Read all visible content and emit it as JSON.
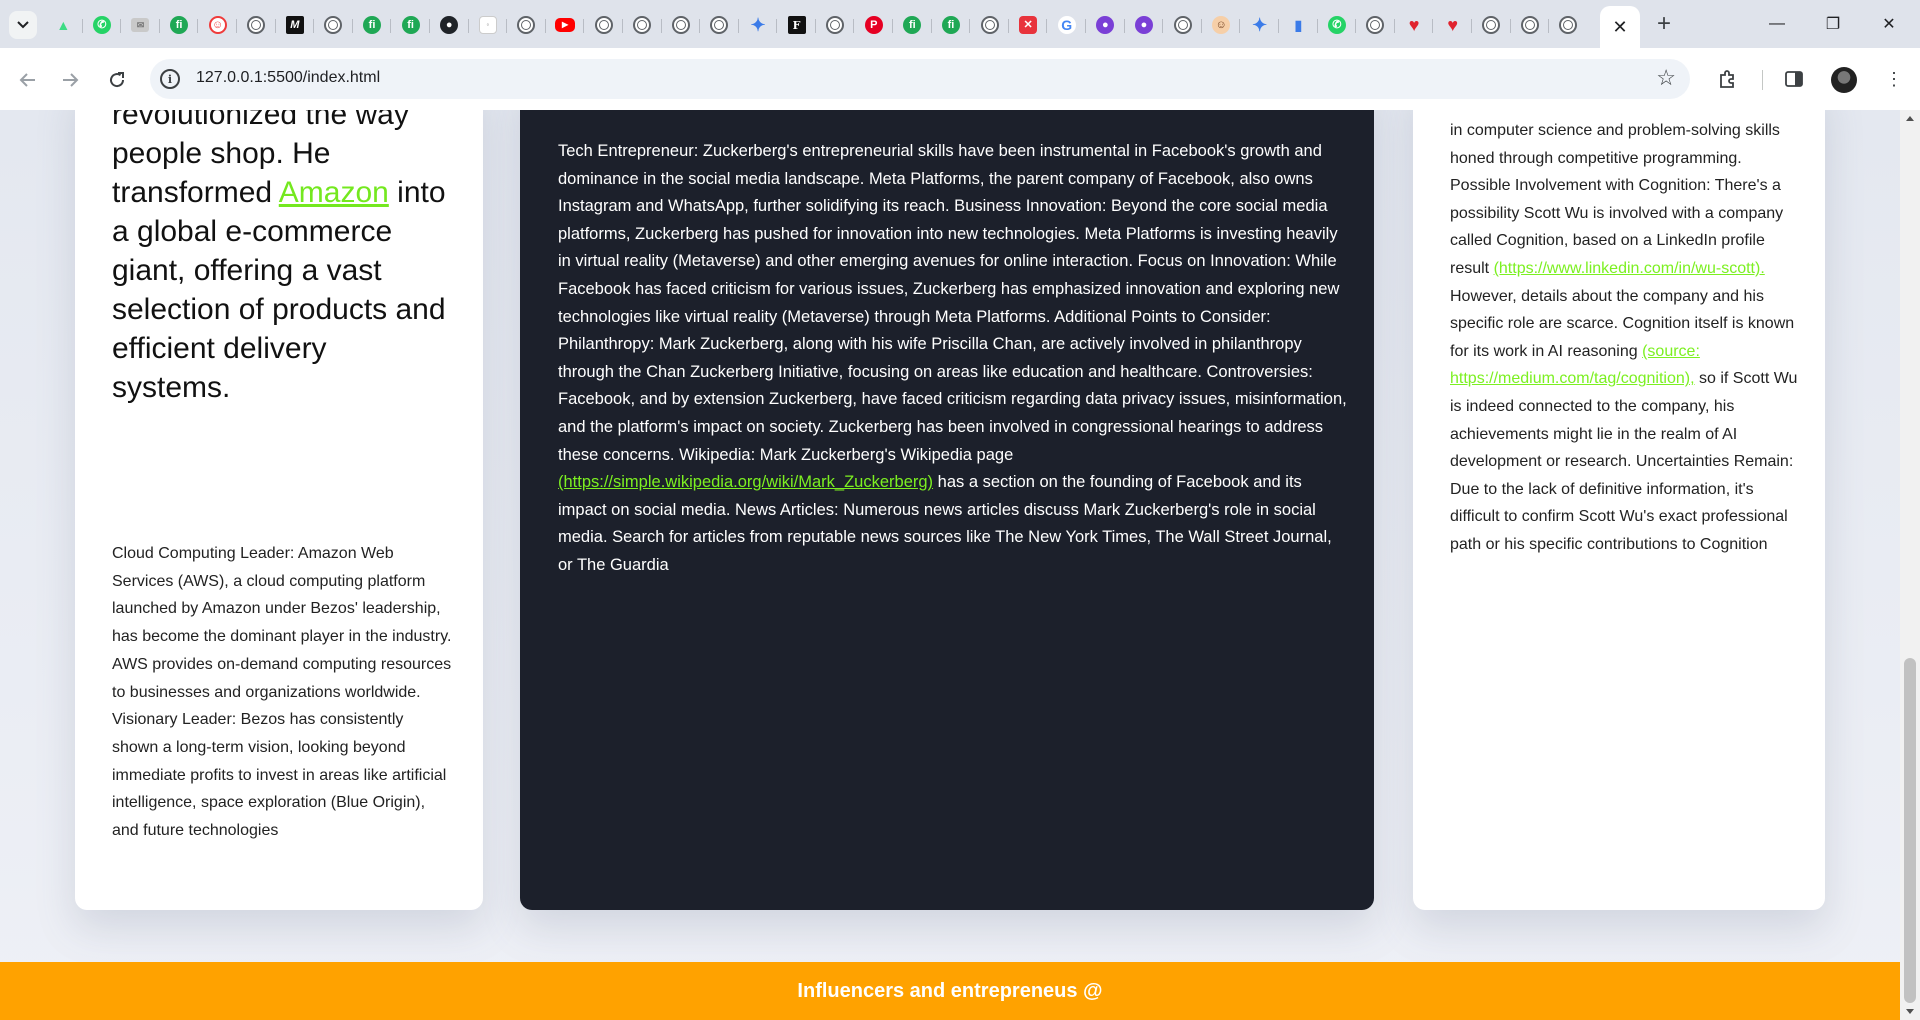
{
  "browser": {
    "url": "127.0.0.1:5500/index.html",
    "tab_favicons": [
      "chevron-down-icon",
      "android-icon",
      "whatsapp-icon",
      "mail-icon",
      "fiverr-icon",
      "smiley-icon",
      "chrome-icon",
      "medium-icon",
      "chrome-icon",
      "fiverr-icon",
      "fiverr-icon",
      "github-icon",
      "doc-icon",
      "chrome-icon",
      "youtube-icon",
      "chrome-icon",
      "chrome-icon",
      "chrome-icon",
      "chrome-icon",
      "gemini-icon",
      "f-icon",
      "chrome-icon",
      "pinterest-icon",
      "fiverr-icon",
      "fiverr-icon",
      "chrome-icon",
      "x-icon",
      "google-icon",
      "octopus-icon",
      "octopus-icon",
      "chrome-icon",
      "face-icon",
      "gemini-icon",
      "bar-chart-icon",
      "whatsapp-icon",
      "chrome-icon",
      "heart-icon",
      "heart-icon",
      "chrome-icon",
      "chrome-icon",
      "chrome-icon"
    ],
    "active_tab_close": "✕",
    "new_tab": "+",
    "minimize": "—",
    "restore": "❐",
    "close": "✕"
  },
  "left_card": {
    "heading_pre": "revolutionized the way people shop. He transformed",
    "heading_link": "Amazon",
    "heading_post": "into a global e-commerce giant, offering a vast selection of products and efficient delivery systems.",
    "body": "Cloud Computing Leader: Amazon Web Services (AWS), a cloud computing platform launched by Amazon under Bezos' leadership, has become the dominant player in the industry. AWS provides on-demand computing resources to businesses and organizations worldwide. Visionary Leader: Bezos has consistently shown a long-term vision, looking beyond immediate profits to invest in areas like artificial intelligence, space exploration (Blue Origin), and future technologies"
  },
  "middle_card": {
    "body_pre": "Tech Entrepreneur: Zuckerberg's entrepreneurial skills have been instrumental in Facebook's growth and dominance in the social media landscape. Meta Platforms, the parent company of Facebook, also owns Instagram and WhatsApp, further solidifying its reach. Business Innovation: Beyond the core social media platforms, Zuckerberg has pushed for innovation into new technologies. Meta Platforms is investing heavily in virtual reality (Metaverse) and other emerging avenues for online interaction. Focus on Innovation: While Facebook has faced criticism for various issues, Zuckerberg has emphasized innovation and exploring new technologies like virtual reality (Metaverse) through Meta Platforms. Additional Points to Consider: Philanthropy: Mark Zuckerberg, along with his wife Priscilla Chan, are actively involved in philanthropy through the Chan Zuckerberg Initiative, focusing on areas like education and healthcare. Controversies: Facebook, and by extension Zuckerberg, have faced criticism regarding data privacy issues, misinformation, and the platform's impact on society. Zuckerberg has been involved in congressional hearings to address these concerns. Wikipedia: Mark Zuckerberg's Wikipedia page",
    "link": "(https://simple.wikipedia.org/wiki/Mark_Zuckerberg)",
    "body_post": "has a section on the founding of Facebook and its impact on social media. News Articles: Numerous news articles discuss Mark Zuckerberg's role in social media. Search for articles from reputable news sources like The New York Times, The Wall Street Journal, or The Guardia"
  },
  "right_card": {
    "body_1": "in computer science and problem-solving skills honed through competitive programming. Possible Involvement with Cognition: There's a possibility Scott Wu is involved with a company called Cognition, based on a LinkedIn profile result",
    "link_1": "(https://www.linkedin.com/in/wu-scott).",
    "body_2": "However, details about the company and his specific role are scarce. Cognition itself is known for its work in AI reasoning",
    "link_2": "(source: https://medium.com/tag/cognition),",
    "body_3": "so if Scott Wu is indeed connected to the company, his achievements might lie in the realm of AI development or research. Uncertainties Remain: Due to the lack of definitive information, it's difficult to confirm Scott Wu's exact professional path or his specific contributions to Cognition"
  },
  "footer": {
    "text": "Influencers and entrepreneus @"
  },
  "colors": {
    "accent_link": "#7cf021",
    "footer_bg": "#ffa200",
    "dark_card": "#1c202b"
  }
}
